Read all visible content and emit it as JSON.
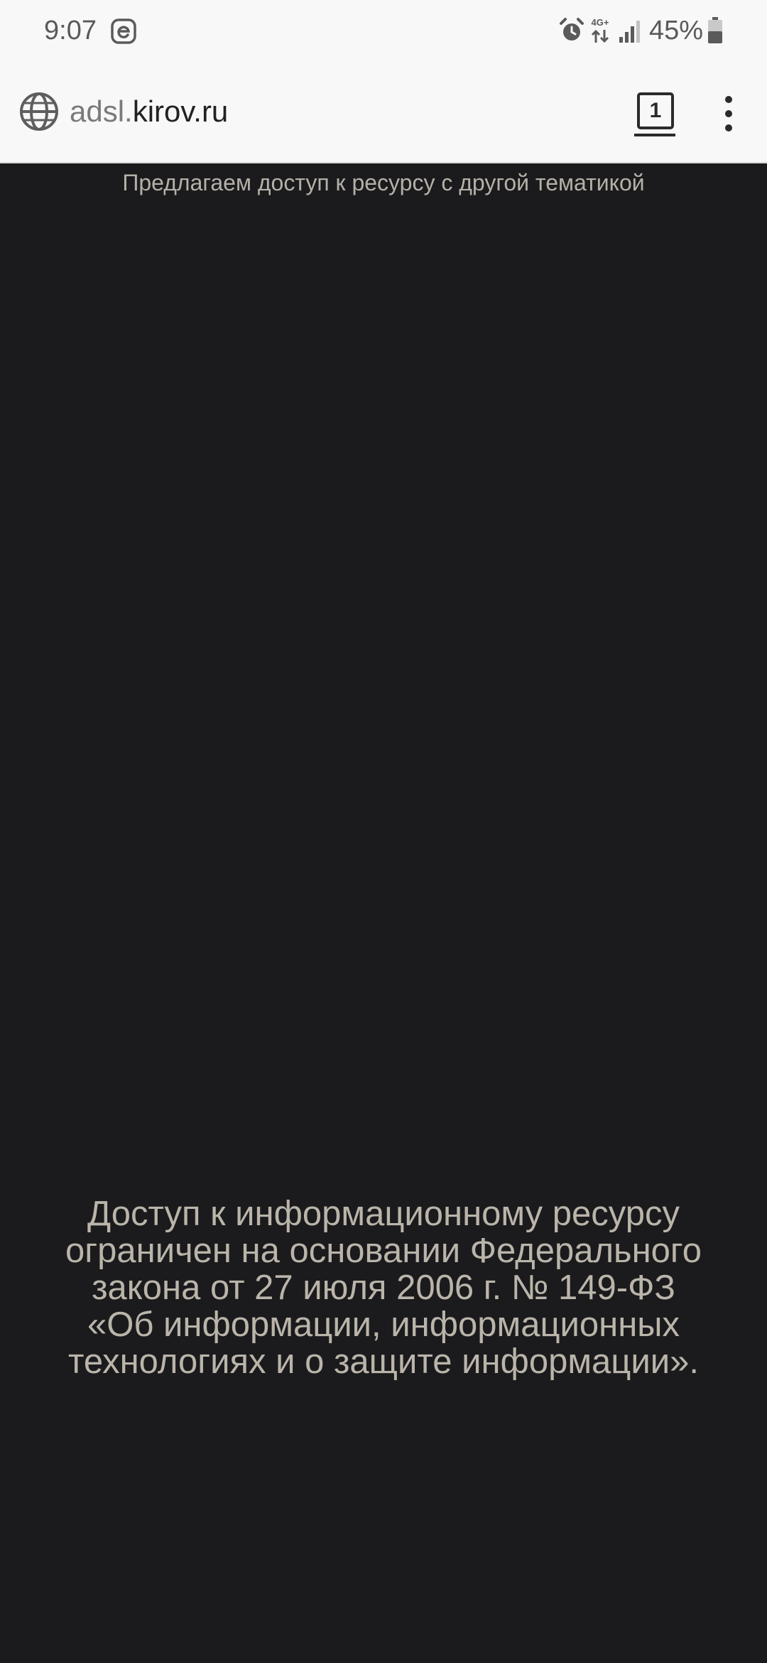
{
  "status_bar": {
    "time": "9:07",
    "notification_icon": "e-app-icon",
    "icons": [
      "alarm-icon",
      "4g-network-icon",
      "signal-icon",
      "battery-icon"
    ],
    "network_label": "4G+",
    "battery_percent": "45%"
  },
  "toolbar": {
    "url_subdomain": "adsl.",
    "url_domain": "kirov.ru",
    "tab_count": "1",
    "site_icon": "globe-icon",
    "menu_icon": "more-vert-icon"
  },
  "page": {
    "offer_text": "Предлагаем доступ к ресурсу с другой тематикой",
    "notice_lines": [
      "Доступ к информационному ресурсу",
      "ограничен на основании Федерального",
      "закона от 27 июля 2006 г. № 149-ФЗ",
      "«Об информации, информационных",
      "технологиях и о защите информации»."
    ]
  },
  "colors": {
    "chrome_background": "#f8f8f8",
    "page_background": "#1b1b1d",
    "page_text": "#bab4aa"
  }
}
